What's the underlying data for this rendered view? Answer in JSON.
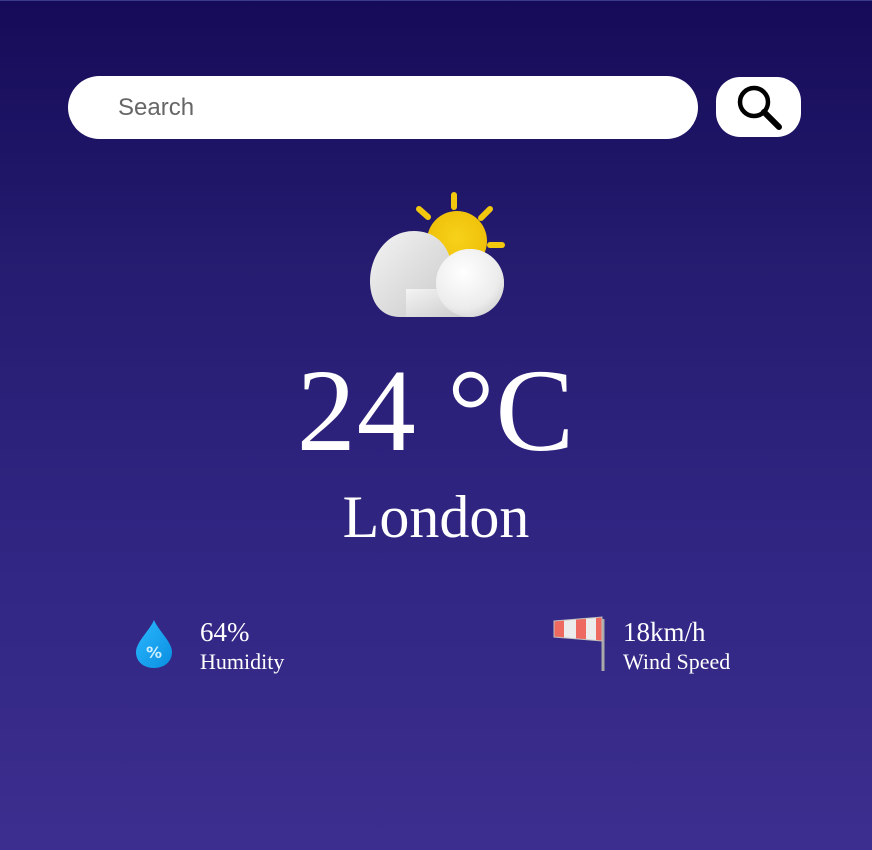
{
  "search": {
    "placeholder": "Search",
    "button_icon": "search-icon"
  },
  "weather": {
    "condition_icon": "partly-cloudy-icon",
    "temperature": "24 °C",
    "city": "London"
  },
  "stats": {
    "humidity": {
      "icon": "humidity-drop-icon",
      "value": "64%",
      "label": "Humidity"
    },
    "wind": {
      "icon": "windsock-icon",
      "value": "18km/h",
      "label": "Wind Speed"
    }
  },
  "colors": {
    "background_top": "#150b58",
    "background_bottom": "#3c2e8e",
    "sun": "#f2c80f",
    "drop": "#1aa3f0",
    "windsock": "#f07068"
  }
}
